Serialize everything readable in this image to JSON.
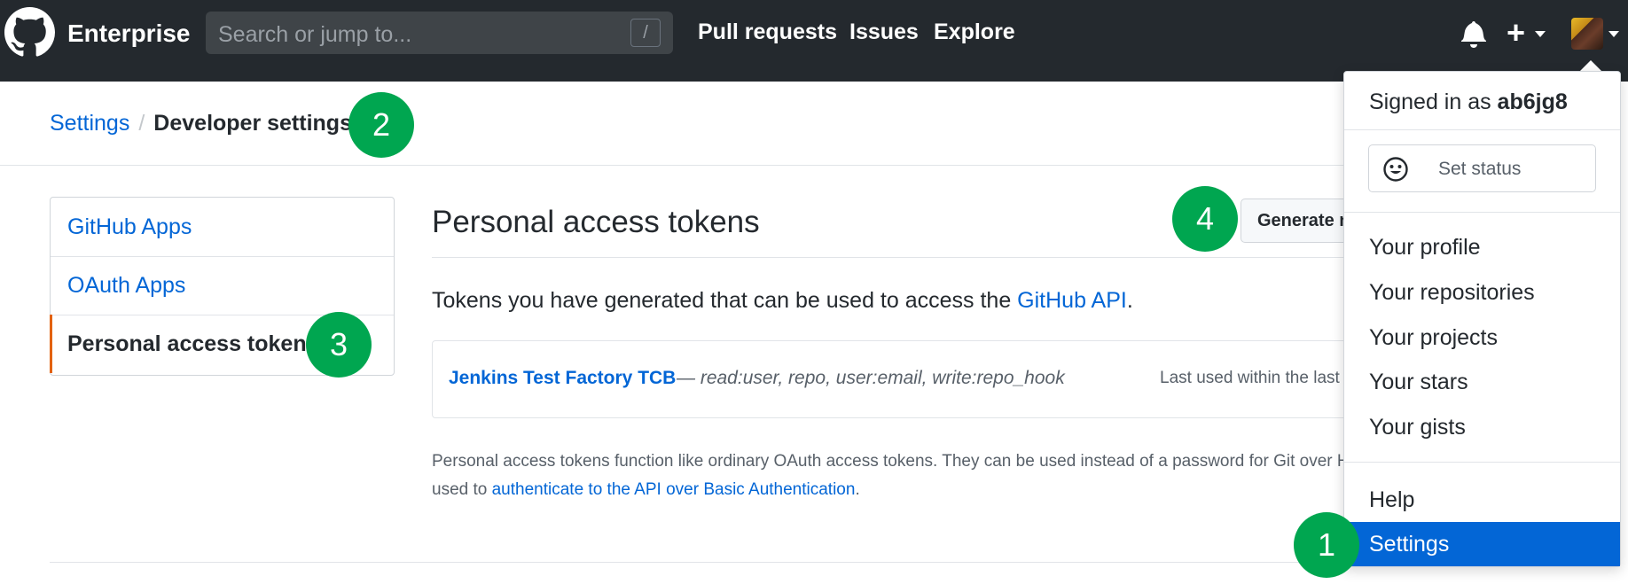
{
  "header": {
    "brand": "Enterprise",
    "search_placeholder": "Search or jump to...",
    "search_shortcut": "/",
    "nav": [
      "Pull requests",
      "Issues",
      "Explore"
    ],
    "icons": [
      "github-logo-icon",
      "bell-icon",
      "plus-icon",
      "caret-down-icon",
      "avatar"
    ]
  },
  "breadcrumb": {
    "parent": "Settings",
    "separator": "/",
    "current": "Developer settings"
  },
  "sidebar": {
    "items": [
      {
        "label": "GitHub Apps",
        "active": false
      },
      {
        "label": "OAuth Apps",
        "active": false
      },
      {
        "label": "Personal access tokens",
        "active": true
      }
    ]
  },
  "main": {
    "title": "Personal access tokens",
    "generate_button": "Generate new token",
    "intro_text": "Tokens you have generated that can be used to access the ",
    "intro_link": "GitHub API",
    "intro_end": ".",
    "token": {
      "name": "Jenkins Test Factory TCB",
      "scopes": " — read:user, repo, user:email, write:repo_hook",
      "last_used": "Last used within the last week"
    },
    "note_line1": "Personal access tokens function like ordinary OAuth access tokens. They can be used instead of a password for Git over HTTPS, or can be",
    "note_line2_prefix": "used to ",
    "note_link": "authenticate to the API over Basic Authentication",
    "note_line2_suffix": "."
  },
  "dropdown": {
    "signed_in_prefix": "Signed in as ",
    "username": "ab6jg8",
    "set_status": "Set status",
    "items": [
      "Your profile",
      "Your repositories",
      "Your projects",
      "Your stars",
      "Your gists"
    ],
    "help": "Help",
    "settings": "Settings"
  },
  "callouts": [
    "1",
    "2",
    "3",
    "4"
  ],
  "colors": {
    "header_bg": "#24292e",
    "link": "#0366d6",
    "selected_bg": "#0366d6",
    "callout": "#00a650",
    "active_marker": "#e36209"
  }
}
